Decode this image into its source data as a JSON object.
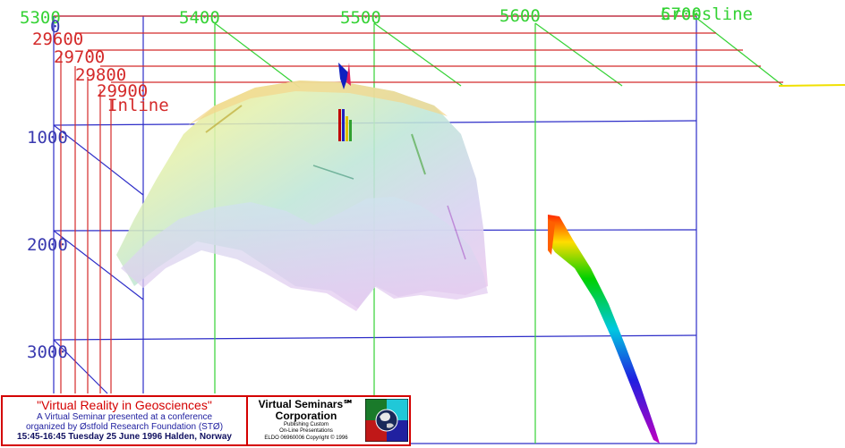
{
  "axes": {
    "crossline": {
      "title": "Crossline",
      "ticks": [
        "5300",
        "5400",
        "5500",
        "5600",
        "5700"
      ],
      "color": "#35d235"
    },
    "inline": {
      "title": "Inline",
      "ticks": [
        "29600",
        "29700",
        "29800",
        "29900"
      ],
      "color": "#d42a2a"
    },
    "depth": {
      "ticks": [
        "0",
        "1000",
        "2000",
        "3000"
      ],
      "color": "#3a3ab0"
    }
  },
  "banner": {
    "title": "\"Virtual Reality in Geosciences\"",
    "line1": "A Virtual Seminar presented at a conference",
    "line2": "organized by Østfold Research Foundation (STØ)",
    "line3": "15:45-16:45 Tuesday 25 June 1996 Halden, Norway",
    "company_line1": "Virtual Seminars℠",
    "company_line2": "Corporation",
    "tagline1": "Publishing Custom",
    "tagline2": "On-Line Presentations",
    "copyright": "ELDO 06960006 Copyright © 1996",
    "logo_icon": "globe-quadrant-logo-icon"
  }
}
